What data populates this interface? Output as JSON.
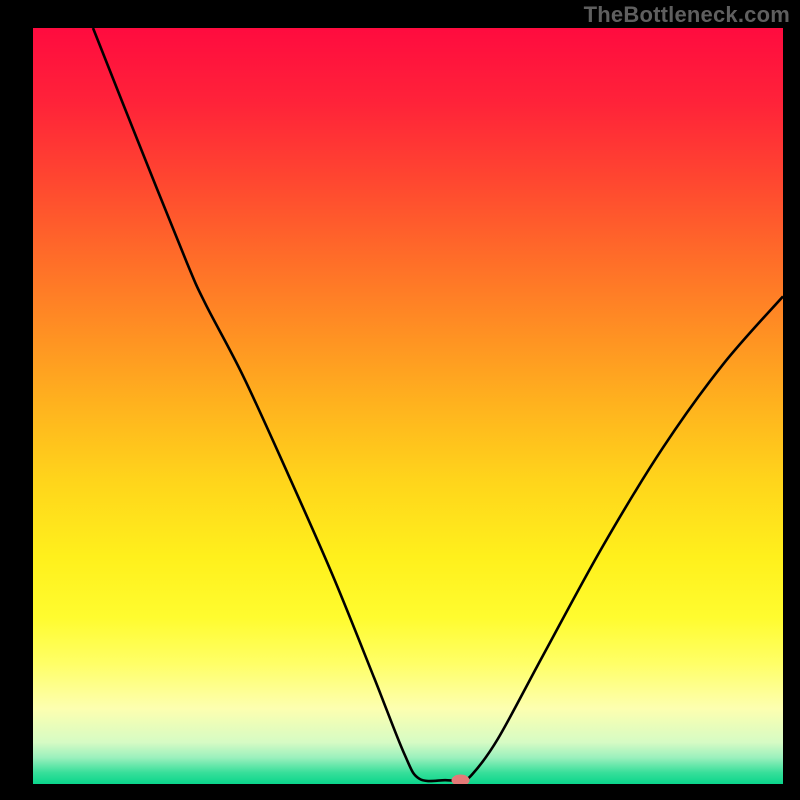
{
  "watermark": "TheBottleneck.com",
  "chart_data": {
    "type": "line",
    "title": "",
    "xlabel": "",
    "ylabel": "",
    "xlim": [
      0,
      100
    ],
    "ylim": [
      0,
      100
    ],
    "grid": false,
    "background_gradient": {
      "stops": [
        {
          "pos": 0.0,
          "color": "#ff0b3f"
        },
        {
          "pos": 0.1,
          "color": "#ff2339"
        },
        {
          "pos": 0.2,
          "color": "#ff4630"
        },
        {
          "pos": 0.3,
          "color": "#ff6b29"
        },
        {
          "pos": 0.4,
          "color": "#ff8f23"
        },
        {
          "pos": 0.5,
          "color": "#ffb31e"
        },
        {
          "pos": 0.6,
          "color": "#ffd51b"
        },
        {
          "pos": 0.7,
          "color": "#fff01c"
        },
        {
          "pos": 0.78,
          "color": "#fffc2f"
        },
        {
          "pos": 0.84,
          "color": "#ffff66"
        },
        {
          "pos": 0.9,
          "color": "#fdffb0"
        },
        {
          "pos": 0.945,
          "color": "#d6fbc4"
        },
        {
          "pos": 0.965,
          "color": "#9bf0bd"
        },
        {
          "pos": 0.985,
          "color": "#37df9a"
        },
        {
          "pos": 1.0,
          "color": "#0ad58b"
        }
      ]
    },
    "series": [
      {
        "name": "bottleneck-curve",
        "stroke": "#000000",
        "stroke_width": 2.6,
        "points": [
          {
            "x": 8.0,
            "y": 100.0
          },
          {
            "x": 14.0,
            "y": 85.0
          },
          {
            "x": 20.5,
            "y": 69.0
          },
          {
            "x": 23.0,
            "y": 63.5
          },
          {
            "x": 28.0,
            "y": 54.0
          },
          {
            "x": 34.0,
            "y": 41.0
          },
          {
            "x": 40.0,
            "y": 27.5
          },
          {
            "x": 45.5,
            "y": 14.0
          },
          {
            "x": 49.5,
            "y": 4.0
          },
          {
            "x": 51.5,
            "y": 0.7
          },
          {
            "x": 55.0,
            "y": 0.5
          },
          {
            "x": 57.0,
            "y": 0.5
          },
          {
            "x": 58.5,
            "y": 1.2
          },
          {
            "x": 62.0,
            "y": 6.0
          },
          {
            "x": 68.0,
            "y": 17.0
          },
          {
            "x": 76.0,
            "y": 31.5
          },
          {
            "x": 84.0,
            "y": 44.5
          },
          {
            "x": 92.0,
            "y": 55.5
          },
          {
            "x": 100.0,
            "y": 64.5
          }
        ]
      }
    ],
    "marker": {
      "name": "min-marker",
      "x": 57.0,
      "y": 0.5,
      "rx": 1.2,
      "ry": 0.75,
      "fill": "#e47a78"
    }
  }
}
